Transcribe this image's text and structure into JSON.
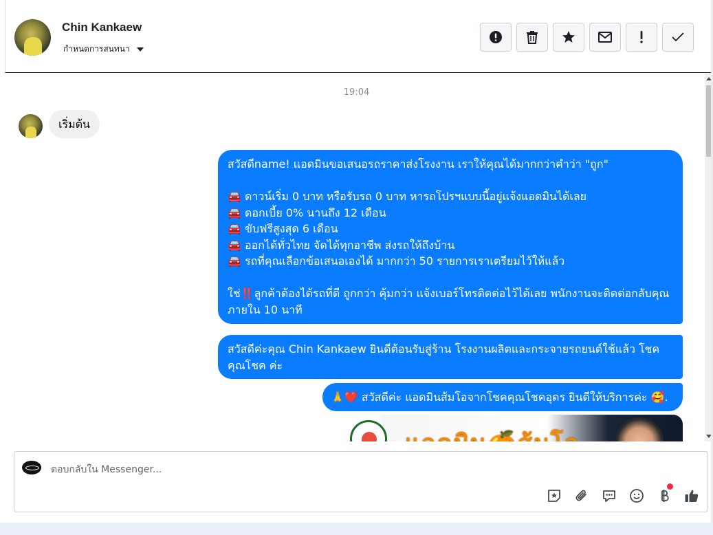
{
  "header": {
    "contact_name": "Chin Kankaew",
    "assign_label": "กำหนดการสนทนา",
    "actions": [
      {
        "name": "report-icon",
        "glyph": "!"
      },
      {
        "name": "trash-icon",
        "glyph": ""
      },
      {
        "name": "star-icon",
        "glyph": "★"
      },
      {
        "name": "mail-icon",
        "glyph": "✉"
      },
      {
        "name": "exclamation-icon",
        "glyph": "!"
      },
      {
        "name": "check-icon",
        "glyph": "✓"
      }
    ]
  },
  "thread": {
    "timestamp": "19:04",
    "incoming": {
      "text": "เริ่มต้น"
    },
    "outgoing": [
      {
        "text": "สวัสดีname! แอดมินขอเสนอรถราคาส่งโรงงาน เราให้คุณได้มากกว่าคำว่า \"ถูก\"\n\n🚘 ดาวน์เริ่ม 0 บาท หรือรับรถ 0 บาท หารถโปรฯแบบนี้อยู่แจ้งแอดมินได้เลย\n🚘 ดอกเบี้ย 0% นานถึง 12 เดือน\n🚘 ขับฟรีสูงสุด 6 เดือน\n🚘 ออกได้ทั่วไทย จัดได้ทุกอาชีพ ส่งรถให้ถึงบ้าน\n🚘 รถที่คุณเลือกข้อเสนอเองได้ มากกว่า 50 รายการเราเตรียมไว้ให้แล้ว\n\nใช่‼️ลูกค้าต้องได้รถที่ดี ถูกกว่า คุ้มกว่า แจ้งเบอร์โทรติดต่อไว้ได้เลย พนักงานจะติดต่อกลับคุณภายใน 10 นาที"
      },
      {
        "text": "สวัสดีค่ะคุณ Chin Kankaew ยินดีต้อนรับสู่ร้าน โรงงานผลิตและกระจายรถยนต์ใช้แล้ว โชคคุณโชค ค่ะ"
      },
      {
        "text": "🙏❤️ สวัสดีค่ะ แอดมินส้มโอจากโชคคุณโชคอุดร ยินดีให้บริการค่ะ 🥰."
      }
    ],
    "image_preview_text": "แอดมิน🍊ส้มโอ"
  },
  "composer": {
    "placeholder": "ตอบกลับใน Messenger...",
    "tools": [
      "sticker-icon",
      "attachment-icon",
      "saved-replies-icon",
      "emoji-icon",
      "payment-icon",
      "like-icon"
    ]
  },
  "colors": {
    "outgoing_bubble": "#0a7cff",
    "incoming_bubble": "#f0f0f0",
    "notification_dot": "#f02849"
  }
}
